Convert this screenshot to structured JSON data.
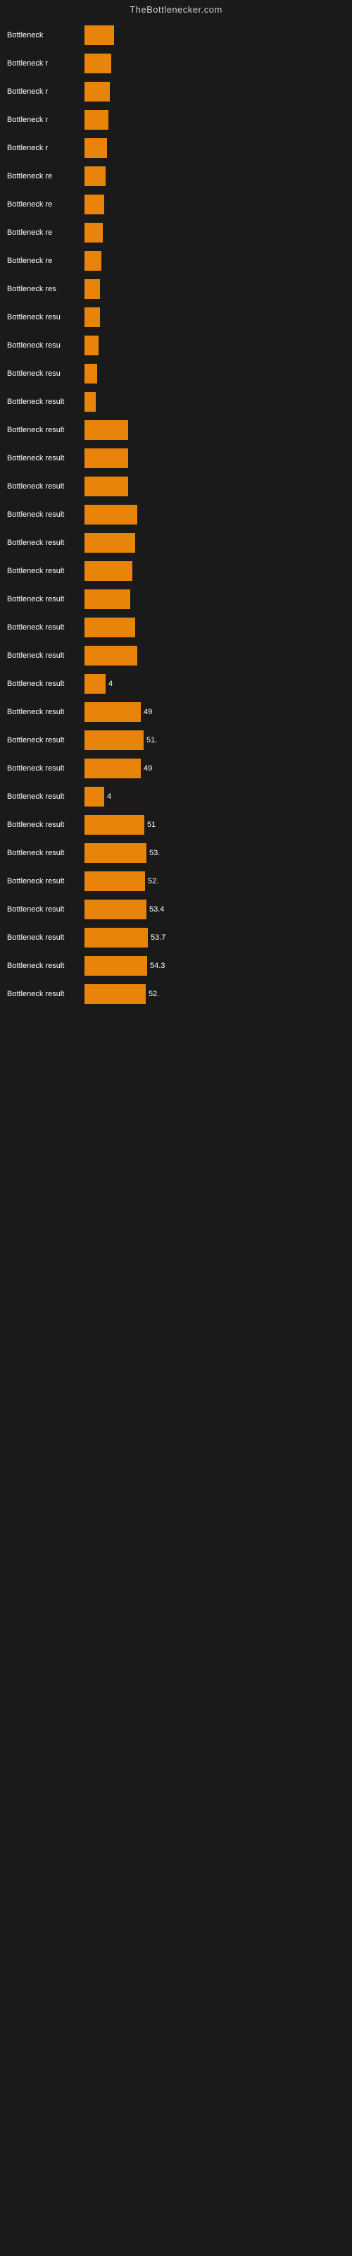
{
  "site_title": "TheBottlenecker.com",
  "rows": [
    {
      "label": "Bottleneck",
      "width": 42,
      "value": ""
    },
    {
      "label": "Bottleneck r",
      "width": 38,
      "value": ""
    },
    {
      "label": "Bottleneck r",
      "width": 36,
      "value": ""
    },
    {
      "label": "Bottleneck r",
      "width": 34,
      "value": ""
    },
    {
      "label": "Bottleneck r",
      "width": 32,
      "value": ""
    },
    {
      "label": "Bottleneck re",
      "width": 30,
      "value": ""
    },
    {
      "label": "Bottleneck re",
      "width": 28,
      "value": ""
    },
    {
      "label": "Bottleneck re",
      "width": 26,
      "value": ""
    },
    {
      "label": "Bottleneck re",
      "width": 24,
      "value": ""
    },
    {
      "label": "Bottleneck res",
      "width": 22,
      "value": ""
    },
    {
      "label": "Bottleneck resu",
      "width": 22,
      "value": ""
    },
    {
      "label": "Bottleneck resu",
      "width": 20,
      "value": ""
    },
    {
      "label": "Bottleneck resu",
      "width": 18,
      "value": ""
    },
    {
      "label": "Bottleneck result",
      "width": 16,
      "value": ""
    },
    {
      "label": "Bottleneck result",
      "width": 62,
      "value": ""
    },
    {
      "label": "Bottleneck result",
      "width": 62,
      "value": ""
    },
    {
      "label": "Bottleneck result",
      "width": 62,
      "value": ""
    },
    {
      "label": "Bottleneck result",
      "width": 75,
      "value": ""
    },
    {
      "label": "Bottleneck result",
      "width": 72,
      "value": ""
    },
    {
      "label": "Bottleneck result",
      "width": 68,
      "value": ""
    },
    {
      "label": "Bottleneck result",
      "width": 65,
      "value": ""
    },
    {
      "label": "Bottleneck result",
      "width": 72,
      "value": ""
    },
    {
      "label": "Bottleneck result",
      "width": 75,
      "value": ""
    },
    {
      "label": "Bottleneck result",
      "width": 30,
      "value": "4"
    },
    {
      "label": "Bottleneck result",
      "width": 80,
      "value": "49"
    },
    {
      "label": "Bottleneck result",
      "width": 84,
      "value": "51."
    },
    {
      "label": "Bottleneck result",
      "width": 80,
      "value": "49"
    },
    {
      "label": "Bottleneck result",
      "width": 28,
      "value": "4"
    },
    {
      "label": "Bottleneck result",
      "width": 85,
      "value": "51"
    },
    {
      "label": "Bottleneck result",
      "width": 88,
      "value": "53."
    },
    {
      "label": "Bottleneck result",
      "width": 86,
      "value": "52."
    },
    {
      "label": "Bottleneck result",
      "width": 88,
      "value": "53.4"
    },
    {
      "label": "Bottleneck result",
      "width": 90,
      "value": "53.7"
    },
    {
      "label": "Bottleneck result",
      "width": 89,
      "value": "54.3"
    },
    {
      "label": "Bottleneck result",
      "width": 87,
      "value": "52."
    }
  ]
}
